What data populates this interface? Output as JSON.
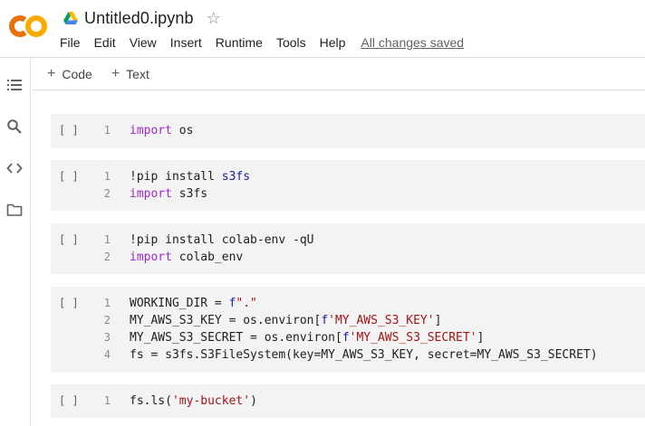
{
  "header": {
    "notebook_title": "Untitled0.ipynb",
    "save_status": "All changes saved",
    "menu": [
      "File",
      "Edit",
      "View",
      "Insert",
      "Runtime",
      "Tools",
      "Help"
    ],
    "logo_text": "CO",
    "colors": {
      "logo_orange": "#F9AB00",
      "logo_dark_orange": "#E8710A"
    }
  },
  "rail": {
    "icons": [
      "table-of-contents-icon",
      "search-icon",
      "code-snippets-icon",
      "files-icon"
    ]
  },
  "toolbar": {
    "code_label": "Code",
    "text_label": "Text"
  },
  "cells": [
    {
      "run": "[ ]",
      "lines": [
        {
          "n": "1",
          "parts": [
            [
              "kw",
              "import"
            ],
            [
              "",
              " os"
            ]
          ]
        }
      ]
    },
    {
      "run": "[ ]",
      "lines": [
        {
          "n": "1",
          "parts": [
            [
              "",
              "!pip install "
            ],
            [
              "fn",
              "s3fs"
            ]
          ]
        },
        {
          "n": "2",
          "parts": [
            [
              "kw",
              "import"
            ],
            [
              "",
              " s3fs"
            ]
          ]
        }
      ]
    },
    {
      "run": "[ ]",
      "lines": [
        {
          "n": "1",
          "parts": [
            [
              "",
              "!pip install colab-env -qU"
            ]
          ]
        },
        {
          "n": "2",
          "parts": [
            [
              "kw",
              "import"
            ],
            [
              "",
              " colab_env"
            ]
          ]
        }
      ]
    },
    {
      "run": "[ ]",
      "lines": [
        {
          "n": "1",
          "parts": [
            [
              "",
              "WORKING_DIR = "
            ],
            [
              "fn",
              "f"
            ],
            [
              "str",
              "\".\""
            ]
          ]
        },
        {
          "n": "2",
          "parts": [
            [
              "",
              "MY_AWS_S3_KEY = os.environ["
            ],
            [
              "fn",
              "f"
            ],
            [
              "str",
              "'MY_AWS_S3_KEY'"
            ],
            [
              "",
              "]"
            ]
          ]
        },
        {
          "n": "3",
          "parts": [
            [
              "",
              "MY_AWS_S3_SECRET = os.environ["
            ],
            [
              "fn",
              "f"
            ],
            [
              "str",
              "'MY_AWS_S3_SECRET'"
            ],
            [
              "",
              "]"
            ]
          ]
        },
        {
          "n": "4",
          "parts": [
            [
              "",
              "fs = s3fs.S3FileSystem(key=MY_AWS_S3_KEY, secret=MY_AWS_S3_SECRET)"
            ]
          ]
        }
      ]
    },
    {
      "run": "[ ]",
      "lines": [
        {
          "n": "1",
          "parts": [
            [
              "",
              "fs.ls("
            ],
            [
              "str",
              "'my-bucket'"
            ],
            [
              "",
              ")"
            ]
          ]
        }
      ]
    }
  ]
}
